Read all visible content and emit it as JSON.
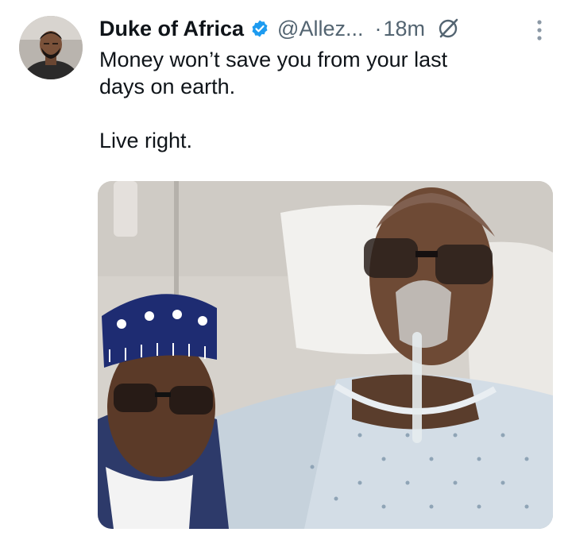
{
  "tweet": {
    "display_name": "Duke of Africa",
    "handle": "@Allez...",
    "separator": "·",
    "time": "18m",
    "text_lines": [
      "Money won’t save you from your last",
      "days on earth."
    ],
    "text_line_2": "Live right.",
    "icons": {
      "verified": "verified-badge-icon",
      "grok": "grok-icon",
      "more": "more-vertical-icon"
    },
    "colors": {
      "verified_blue": "#1d9bf0",
      "secondary_text": "#536471",
      "primary_text": "#0f1419"
    }
  }
}
